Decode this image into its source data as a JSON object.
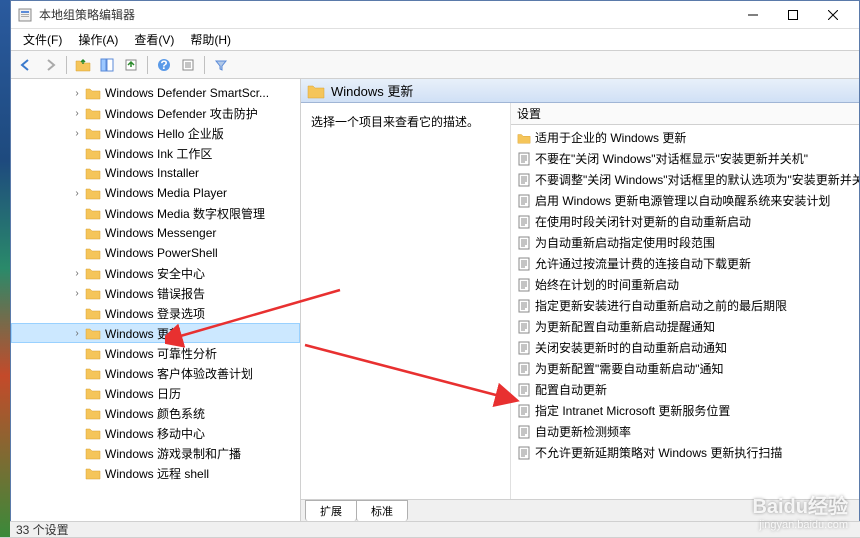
{
  "window": {
    "title": "本地组策略编辑器"
  },
  "menubar": {
    "items": [
      "文件(F)",
      "操作(A)",
      "查看(V)",
      "帮助(H)"
    ]
  },
  "tree": {
    "items": [
      {
        "label": "Windows Defender SmartScr...",
        "expandable": true
      },
      {
        "label": "Windows Defender 攻击防护",
        "expandable": true
      },
      {
        "label": "Windows Hello 企业版",
        "expandable": true
      },
      {
        "label": "Windows Ink 工作区",
        "expandable": false
      },
      {
        "label": "Windows Installer",
        "expandable": false
      },
      {
        "label": "Windows Media Player",
        "expandable": true
      },
      {
        "label": "Windows Media 数字权限管理",
        "expandable": false
      },
      {
        "label": "Windows Messenger",
        "expandable": false
      },
      {
        "label": "Windows PowerShell",
        "expandable": false
      },
      {
        "label": "Windows 安全中心",
        "expandable": true
      },
      {
        "label": "Windows 错误报告",
        "expandable": true
      },
      {
        "label": "Windows 登录选项",
        "expandable": false
      },
      {
        "label": "Windows 更新",
        "expandable": true,
        "selected": true
      },
      {
        "label": "Windows 可靠性分析",
        "expandable": false
      },
      {
        "label": "Windows 客户体验改善计划",
        "expandable": false
      },
      {
        "label": "Windows 日历",
        "expandable": false
      },
      {
        "label": "Windows 颜色系统",
        "expandable": false
      },
      {
        "label": "Windows 移动中心",
        "expandable": false
      },
      {
        "label": "Windows 游戏录制和广播",
        "expandable": false
      },
      {
        "label": "Windows 远程 shell",
        "expandable": false
      }
    ]
  },
  "rightPanel": {
    "headerTitle": "Windows 更新",
    "description": "选择一个项目来查看它的描述。",
    "columnHeader": "设置",
    "items": [
      {
        "type": "folder",
        "label": "适用于企业的 Windows 更新"
      },
      {
        "type": "setting",
        "label": "不要在\"关闭 Windows\"对话框显示\"安装更新并关机\""
      },
      {
        "type": "setting",
        "label": "不要调整\"关闭 Windows\"对话框里的默认选项为\"安装更新并关机\""
      },
      {
        "type": "setting",
        "label": "启用 Windows 更新电源管理以自动唤醒系统来安装计划"
      },
      {
        "type": "setting",
        "label": "在使用时段关闭针对更新的自动重新启动"
      },
      {
        "type": "setting",
        "label": "为自动重新启动指定使用时段范围"
      },
      {
        "type": "setting",
        "label": "允许通过按流量计费的连接自动下载更新"
      },
      {
        "type": "setting",
        "label": "始终在计划的时间重新启动"
      },
      {
        "type": "setting",
        "label": "指定更新安装进行自动重新启动之前的最后期限"
      },
      {
        "type": "setting",
        "label": "为更新配置自动重新启动提醒通知"
      },
      {
        "type": "setting",
        "label": "关闭安装更新时的自动重新启动通知"
      },
      {
        "type": "setting",
        "label": "为更新配置\"需要自动重新启动\"通知"
      },
      {
        "type": "setting",
        "label": "配置自动更新"
      },
      {
        "type": "setting",
        "label": "指定 Intranet Microsoft 更新服务位置"
      },
      {
        "type": "setting",
        "label": "自动更新检测频率"
      },
      {
        "type": "setting",
        "label": "不允许更新延期策略对 Windows 更新执行扫描"
      }
    ],
    "tabs": [
      "扩展",
      "标准"
    ],
    "activeTab": 0
  },
  "statusbar": {
    "text": "33 个设置"
  },
  "watermark": {
    "line1": "Baidu经验",
    "line2": "jingyan.baidu.com"
  }
}
